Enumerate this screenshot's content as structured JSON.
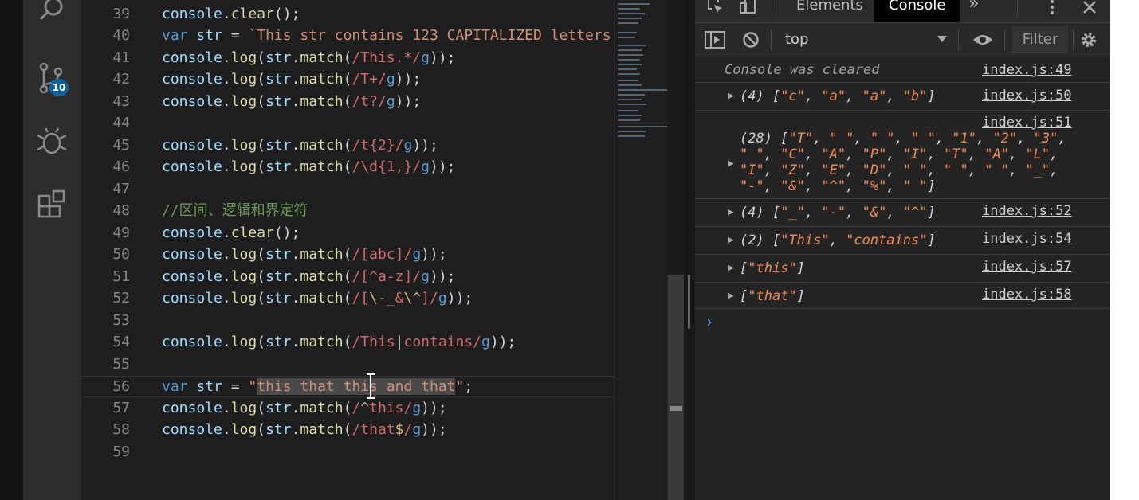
{
  "activity_bar": {
    "icons": [
      "search-icon",
      "source-control-icon",
      "debug-icon",
      "extensions-icon"
    ],
    "scm_badge": "10"
  },
  "editor": {
    "lines": [
      {
        "num": "39",
        "code": "console.clear();"
      },
      {
        "num": "40",
        "code": "var str = `This str contains 123 CAPITALIZED letters"
      },
      {
        "num": "41",
        "code": "console.log(str.match(/This.*/g));"
      },
      {
        "num": "42",
        "code": "console.log(str.match(/T+/g));"
      },
      {
        "num": "43",
        "code": "console.log(str.match(/t?/g));"
      },
      {
        "num": "44",
        "code": ""
      },
      {
        "num": "45",
        "code": "console.log(str.match(/t{2}/g));"
      },
      {
        "num": "46",
        "code": "console.log(str.match(/\\d{1,}/g));"
      },
      {
        "num": "47",
        "code": ""
      },
      {
        "num": "48",
        "code": "//区间、逻辑和界定符"
      },
      {
        "num": "49",
        "code": "console.clear();"
      },
      {
        "num": "50",
        "code": "console.log(str.match(/[abc]/g));"
      },
      {
        "num": "51",
        "code": "console.log(str.match(/[^a-z]/g));"
      },
      {
        "num": "52",
        "code": "console.log(str.match(/[\\-_&\\^]/g));"
      },
      {
        "num": "53",
        "code": ""
      },
      {
        "num": "54",
        "code": "console.log(str.match(/This|contains/g));"
      },
      {
        "num": "55",
        "code": ""
      },
      {
        "num": "56",
        "code": "var str = \"this that this and that\";"
      },
      {
        "num": "57",
        "code": "console.log(str.match(/^this/g));"
      },
      {
        "num": "58",
        "code": "console.log(str.match(/that$/g));"
      },
      {
        "num": "59",
        "code": ""
      }
    ]
  },
  "devtools": {
    "tabs": {
      "elements": "Elements",
      "console": "Console",
      "more": "»"
    },
    "toolbar": {
      "context": "top",
      "filter_placeholder": "Filter"
    },
    "messages": [
      {
        "text": "Console was cleared",
        "source": "index.js:49"
      },
      {
        "text": "(4) [\"c\", \"a\", \"a\", \"b\"]",
        "source": "index.js:50"
      },
      {
        "text": "(28) [\"T\", \" \", \" \", \" \", \"1\", \"2\", \"3\", \" \", \"C\", \"A\", \"P\", \"I\", \"T\", \"A\", \"L\", \"I\", \"Z\", \"E\", \"D\", \" \", \" \", \" \", \"_\", \"-\", \"&\", \"^\", \"%\", \" \"]",
        "source": "index.js:51"
      },
      {
        "text": "(4) [\"_\", \"-\", \"&\", \"^\"]",
        "source": "index.js:52"
      },
      {
        "text": "(2) [\"This\", \"contains\"]",
        "source": "index.js:54"
      },
      {
        "text": "[\"this\"]",
        "source": "index.js:57"
      },
      {
        "text": "[\"that\"]",
        "source": "index.js:58"
      }
    ],
    "prompt": "›"
  },
  "colors": {
    "accent": "#0e639c",
    "string": "#ce9178",
    "regex": "#d16969",
    "keyword": "#569cd6",
    "console_string": "#f28b54"
  }
}
